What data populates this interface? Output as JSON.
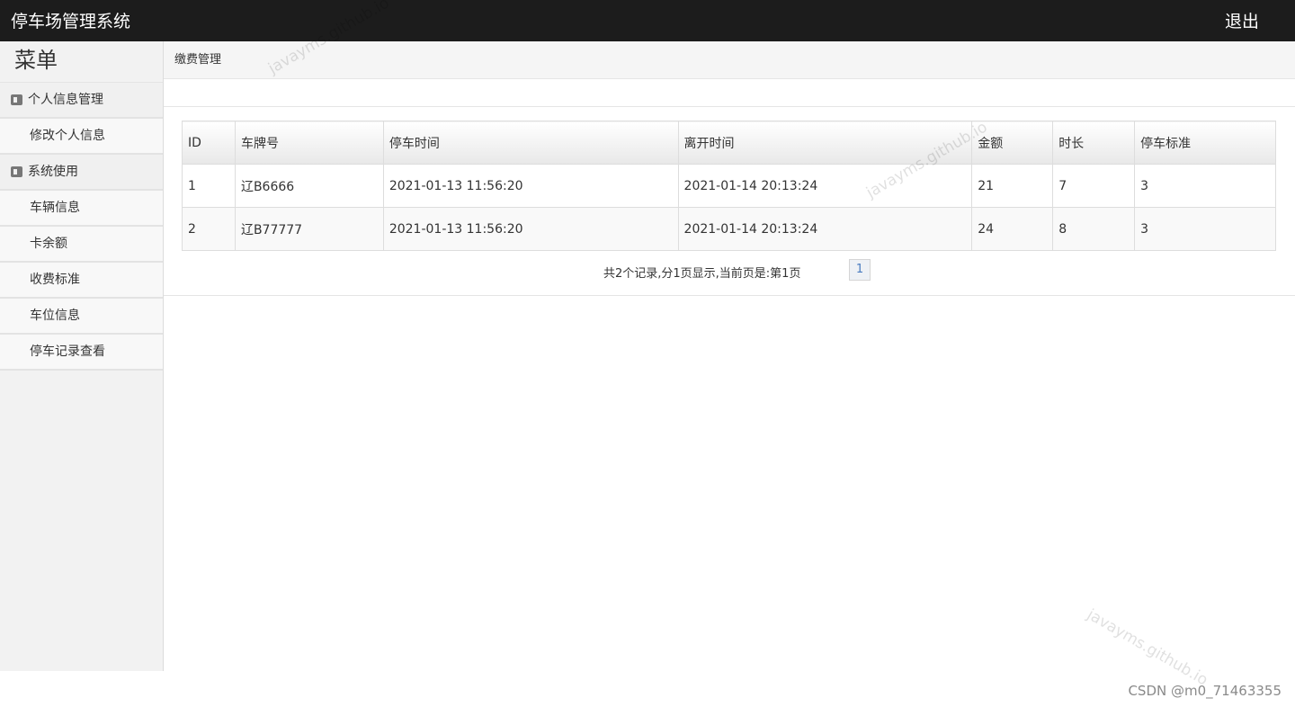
{
  "header": {
    "app_title": "停车场管理系统",
    "logout_label": "退出"
  },
  "sidebar": {
    "menu_title": "菜单",
    "groups": [
      {
        "label": "个人信息管理",
        "items": [
          "修改个人信息"
        ]
      },
      {
        "label": "系统使用",
        "items": [
          "车辆信息",
          "卡余额",
          "收费标准",
          "车位信息",
          "停车记录查看"
        ]
      }
    ]
  },
  "main": {
    "breadcrumb": "缴费管理",
    "table": {
      "columns": [
        "ID",
        "车牌号",
        "停车时间",
        "离开时间",
        "金额",
        "时长",
        "停车标准"
      ],
      "rows": [
        [
          "1",
          "辽B6666",
          "2021-01-13 11:56:20",
          "2021-01-14 20:13:24",
          "21",
          "7",
          "3"
        ],
        [
          "2",
          "辽B77777",
          "2021-01-13 11:56:20",
          "2021-01-14 20:13:24",
          "24",
          "8",
          "3"
        ]
      ]
    },
    "pagination": {
      "info": "共2个记录,分1页显示,当前页是:第1页",
      "page": "1"
    }
  },
  "watermark": {
    "text": "javayms.github.io"
  },
  "footer": {
    "credit": "CSDN @m0_71463355"
  }
}
